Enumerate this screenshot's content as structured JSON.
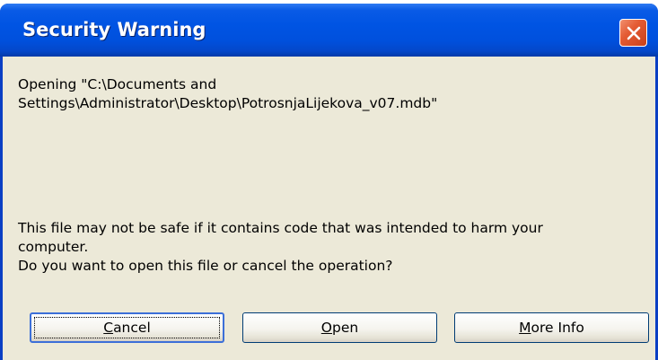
{
  "dialog": {
    "title": "Security Warning",
    "close_icon": "close-x-icon",
    "message_path": "Opening \"C:\\Documents and\nSettings\\Administrator\\Desktop\\PotrosnjaLijekova_v07.mdb\"",
    "warning_line1": "This file may not be safe if it contains code that was intended to harm your",
    "warning_line2": "computer.",
    "warning_line3": "Do you want to open this file or cancel the operation?"
  },
  "buttons": {
    "cancel": {
      "mnemonic": "C",
      "rest": "ancel"
    },
    "open": {
      "mnemonic": "O",
      "rest": "pen"
    },
    "more_info": {
      "mnemonic": "M",
      "rest": "ore Info"
    }
  },
  "colors": {
    "titlebar": "#0054e3",
    "client_bg": "#ece9d8",
    "close_button": "#e45b33",
    "button_border": "#003c74",
    "focus_border": "#3c6fd8"
  }
}
